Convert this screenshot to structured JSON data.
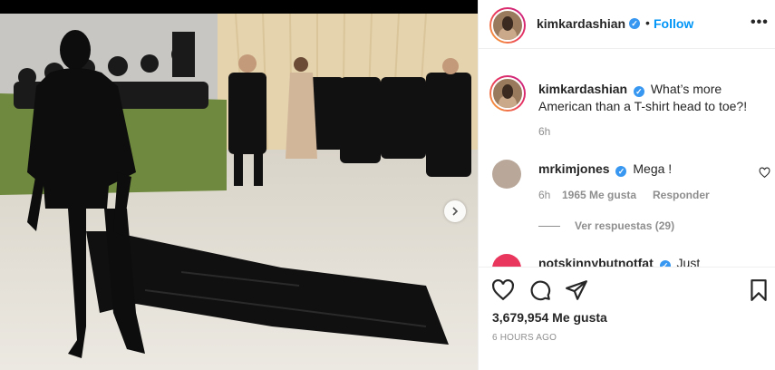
{
  "post": {
    "author": "kimkardashian",
    "follow_label": "Follow",
    "separator": "•",
    "more_label": "•••"
  },
  "caption": {
    "author": "kimkardashian",
    "text": "What’s more American than a T-shirt head to toe?!",
    "age": "6h"
  },
  "comments": [
    {
      "author": "mrkimjones",
      "text": "Mega !",
      "age": "6h",
      "likes": "1965 Me gusta",
      "reply_label": "Responder",
      "view_replies": "Ver respuestas (29)"
    },
    {
      "author": "notskinnybutnotfat",
      "text": "Just"
    }
  ],
  "footer": {
    "likes": "3,679,954 Me gusta",
    "time": "6 HOURS AGO"
  },
  "carousel": {
    "dot_count": 9,
    "active_index": 0
  },
  "colors": {
    "link_blue": "#0095f6",
    "verified_blue": "#3897f0",
    "text": "#262626",
    "muted": "#8e8e8e"
  },
  "icons": [
    "verified-badge-icon",
    "more-options-icon",
    "heart-icon",
    "comment-icon",
    "share-icon",
    "bookmark-icon",
    "chevron-right-icon"
  ]
}
